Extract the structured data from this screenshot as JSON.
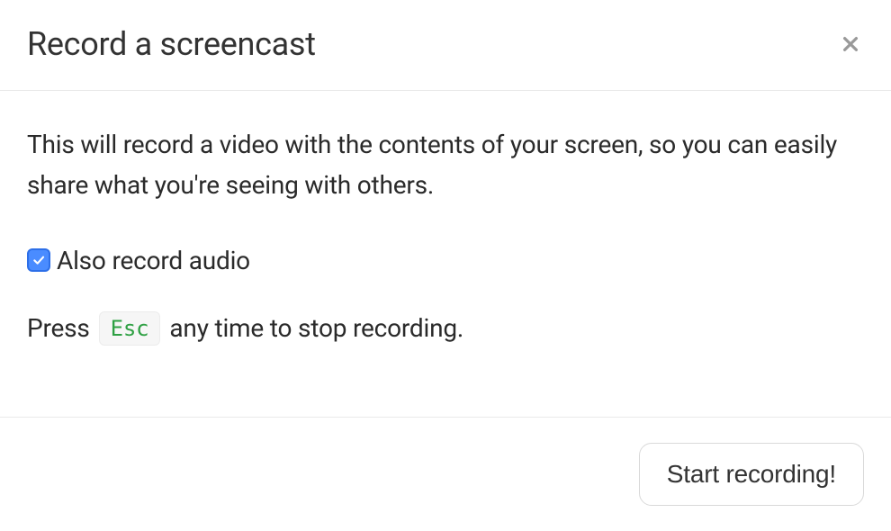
{
  "header": {
    "title": "Record a screencast"
  },
  "body": {
    "description": "This will record a video with the contents of your screen, so you can easily share what you're seeing with others.",
    "checkbox": {
      "label": "Also record audio",
      "checked": true
    },
    "hint": {
      "prefix": "Press",
      "key": "Esc",
      "suffix": " any time to stop recording."
    }
  },
  "footer": {
    "start_label": "Start recording!"
  }
}
